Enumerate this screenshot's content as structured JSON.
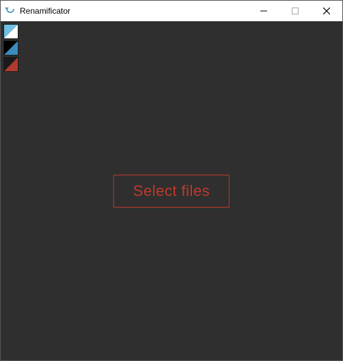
{
  "window": {
    "title": "Renamificator"
  },
  "swatches": {
    "s1_color1": "#6fbfe0",
    "s1_color2": "#ffffff",
    "s2_color1": "#000000",
    "s2_color2": "#3a8cc0",
    "s3_color1": "#1a1a1a",
    "s3_color2": "#b03a2e"
  },
  "main": {
    "select_files_label": "Select files"
  },
  "colors": {
    "background": "#2f2f2f",
    "accent": "#c0392b"
  }
}
